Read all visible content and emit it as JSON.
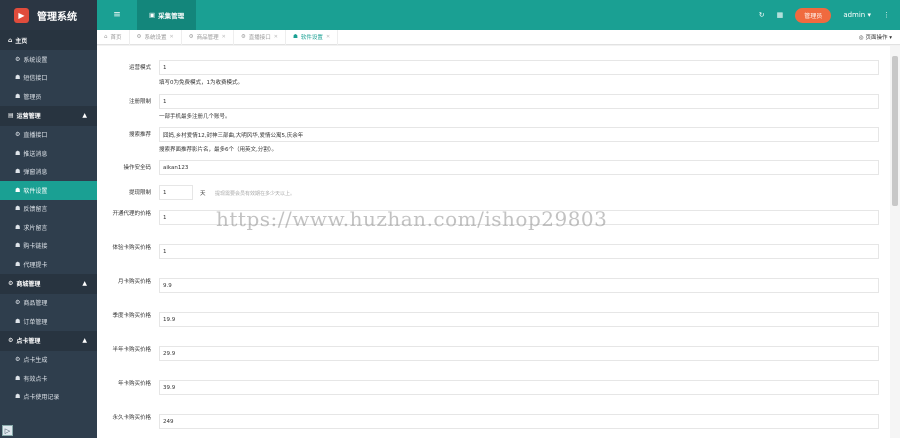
{
  "app": {
    "title": "管理系统"
  },
  "sidebar": {
    "sections": [
      {
        "label": "主页",
        "items": [
          "系统设置",
          "短信接口",
          "管理员"
        ]
      },
      {
        "label": "运营管理",
        "items": [
          "直播接口",
          "推送消息",
          "弹窗消息",
          "软件设置",
          "反馈留言",
          "求片留言",
          "购卡链接",
          "代理提卡"
        ],
        "active": "软件设置"
      },
      {
        "label": "商城管理",
        "items": [
          "商品管理",
          "订单管理"
        ]
      },
      {
        "label": "点卡管理",
        "items": [
          "点卡生成",
          "有效点卡",
          "点卡使用记录"
        ]
      }
    ]
  },
  "topbar": {
    "active_tab": "采集管理",
    "role_button": "管理员",
    "user": "admin"
  },
  "tabs": [
    {
      "label": "首页",
      "closable": false
    },
    {
      "label": "系统设置",
      "closable": true
    },
    {
      "label": "商品管理",
      "closable": true
    },
    {
      "label": "直播接口",
      "closable": true
    },
    {
      "label": "软件设置",
      "closable": true,
      "active": true
    }
  ],
  "page_ops_label": "页面操作",
  "form": {
    "fields": [
      {
        "label": "运营模式",
        "value": "1",
        "hint": "填写0为免费模式，1为收费模式。"
      },
      {
        "label": "注册限制",
        "value": "1",
        "hint": "一部手机最多注册几个账号。"
      },
      {
        "label": "搜索推荐",
        "value": "囧妈,乡村爱情12,封神三部曲,大明风华,爱情公寓5,庆余年",
        "hint": "搜索界面推荐影片名，最多6个（用英文,分割）。"
      },
      {
        "label": "操作安全码",
        "value": "aikan123"
      },
      {
        "label": "提现限制",
        "value": "1",
        "unit": "天",
        "suffix": "提现需要会员有效期在多少天以上。"
      },
      {
        "label": "开通代理的价格",
        "value": "1"
      },
      {
        "label": "体验卡购买价格",
        "value": "1"
      },
      {
        "label": "月卡购买价格",
        "value": "9.9"
      },
      {
        "label": "季度卡购买价格",
        "value": "19.9"
      },
      {
        "label": "半年卡购买价格",
        "value": "29.9"
      },
      {
        "label": "年卡购买价格",
        "value": "39.9"
      },
      {
        "label": "永久卡购买价格",
        "value": "249"
      }
    ]
  },
  "watermark": "https://www.huzhan.com/ishop29803",
  "colors": {
    "accent": "#1aa093",
    "sidebar": "#2f3e4d",
    "role_button": "#f06a3f"
  }
}
